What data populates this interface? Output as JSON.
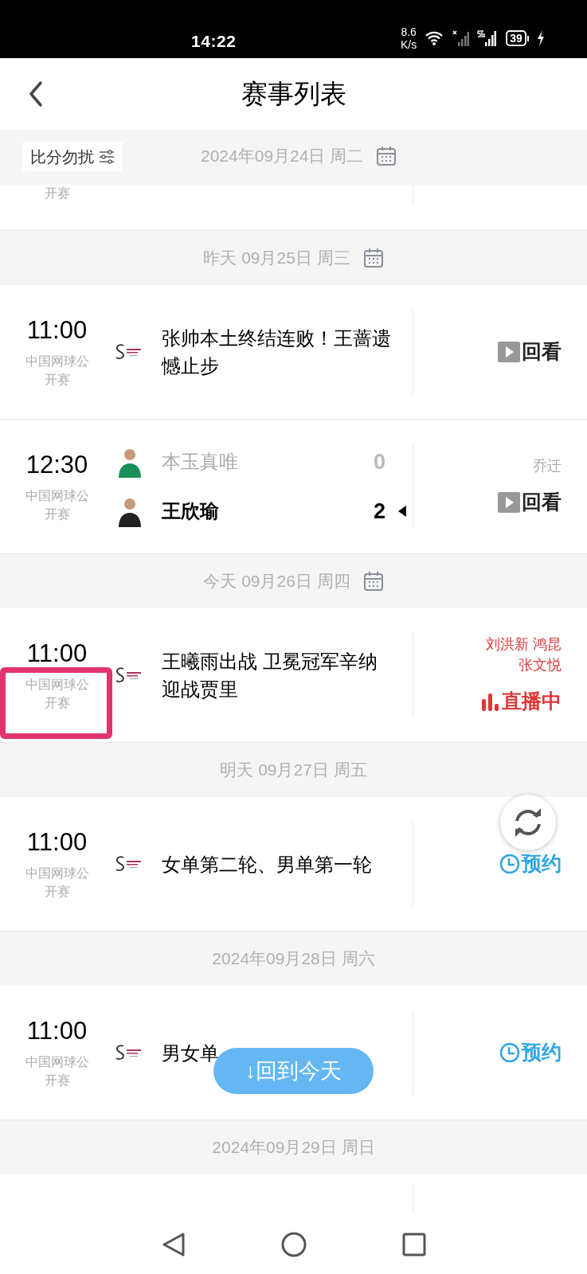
{
  "status_bar": {
    "time": "14:22",
    "net_speed": [
      "8.6",
      "K/s"
    ],
    "battery": "39"
  },
  "header": {
    "title": "赛事列表"
  },
  "sticky_bar": {
    "filter_label": "比分勿扰",
    "date": "2024年09月24日 周二",
    "calendar": true
  },
  "list": [
    {
      "kind": "cut_row",
      "competition_tail": "开赛"
    },
    {
      "kind": "date",
      "label": "昨天 09月25日 周三",
      "calendar": true
    },
    {
      "kind": "match",
      "time": "11:00",
      "competition": "中国网球公开赛",
      "title": "张帅本土终结连败！王蔷遗憾止步",
      "action": {
        "kind": "replay",
        "label": "回看"
      }
    },
    {
      "kind": "match",
      "time": "12:30",
      "competition": "中国网球公开赛",
      "players": [
        {
          "name": "本玉真唯",
          "score": "0",
          "winner": false
        },
        {
          "name": "王欣瑜",
          "score": "2",
          "winner": true
        }
      ],
      "commentators": [
        "乔迁"
      ],
      "action": {
        "kind": "replay",
        "label": "回看"
      }
    },
    {
      "kind": "date",
      "label": "今天 09月26日 周四",
      "calendar": true
    },
    {
      "kind": "match",
      "time": "11:00",
      "competition": "中国网球公开赛",
      "title": "王曦雨出战 卫冕冠军辛纳迎战贾里",
      "commentators": [
        "刘洪新 鸿昆",
        "张文悦"
      ],
      "action": {
        "kind": "live",
        "label": "直播中"
      },
      "highlighted": true
    },
    {
      "kind": "date",
      "label": "明天 09月27日 周五",
      "calendar": false
    },
    {
      "kind": "match",
      "time": "11:00",
      "competition": "中国网球公开赛",
      "title": "女单第二轮、男单第一轮",
      "action": {
        "kind": "reserve",
        "label": "预约"
      }
    },
    {
      "kind": "date",
      "label": "2024年09月28日 周六",
      "calendar": false
    },
    {
      "kind": "match",
      "time": "11:00",
      "competition": "中国网球公开赛",
      "title": "男女单",
      "action": {
        "kind": "reserve",
        "label": "预约"
      }
    },
    {
      "kind": "date",
      "label": "2024年09月29日 周日",
      "calendar": false
    },
    {
      "kind": "cut_top"
    }
  ],
  "back_to_today": {
    "label": "↓回到今天"
  }
}
